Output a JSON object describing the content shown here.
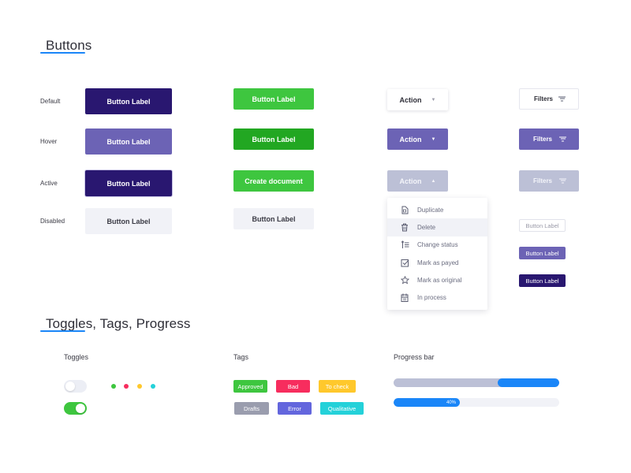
{
  "sections": {
    "buttons_title": "Buttons",
    "toggles_title": "Toggles, Tags, Progress"
  },
  "colors": {
    "accent_blue": "#1a86f8",
    "primary_dark": "#291770",
    "primary_hover": "#6c63b5",
    "green": "#3ec63f",
    "green_hover": "#22a722",
    "disabled_bg": "#f1f2f7",
    "muted_bg": "#bcc0d6"
  },
  "row_labels": {
    "default": "Default",
    "hover": "Hover",
    "active": "Active",
    "disabled": "Disabled"
  },
  "primary_buttons": {
    "default": "Button Label",
    "hover": "Button Label",
    "active": "Button Label",
    "disabled": "Button Label"
  },
  "green_buttons": {
    "default": "Button Label",
    "hover": "Button Label",
    "active": "Create document",
    "disabled": "Button Label"
  },
  "action_buttons": {
    "default": "Action",
    "hover": "Action",
    "active": "Action",
    "caret_down": "▼",
    "caret_up": "▲"
  },
  "filter_buttons": {
    "default": "Filters",
    "hover": "Filters",
    "active": "Filters"
  },
  "small_buttons": {
    "outline": "Button Label",
    "hover": "Button Label",
    "dark": "Button Label"
  },
  "dropdown": {
    "items": [
      {
        "label": "Duplicate",
        "icon": "duplicate-icon"
      },
      {
        "label": "Delete",
        "icon": "trash-icon",
        "highlighted": true
      },
      {
        "label": "Change status",
        "icon": "status-list-icon"
      },
      {
        "label": "Mark as payed",
        "icon": "checkbox-icon"
      },
      {
        "label": "Mark as original",
        "icon": "star-icon"
      },
      {
        "label": "In process",
        "icon": "calendar-icon"
      }
    ]
  },
  "toggles": {
    "title": "Toggles",
    "toggle_1_on": false,
    "toggle_2_on": true,
    "status_dots": [
      "#3ec63f",
      "#f72d5e",
      "#ffc82c",
      "#24d1d9"
    ]
  },
  "tags": {
    "title": "Tags",
    "items": [
      {
        "label": "Approved",
        "color": "#3ec63f"
      },
      {
        "label": "Bad",
        "color": "#f72d5e"
      },
      {
        "label": "To check",
        "color": "#ffc82c"
      },
      {
        "label": "Drafts",
        "color": "#9a9dae"
      },
      {
        "label": "Error",
        "color": "#6366dd"
      },
      {
        "label": "Qualitative",
        "color": "#24d1d9"
      }
    ]
  },
  "progress": {
    "title": "Progress bar",
    "bar_1": {
      "value_percent": 37
    },
    "bar_2": {
      "value_percent": 40,
      "label": "40%"
    }
  }
}
